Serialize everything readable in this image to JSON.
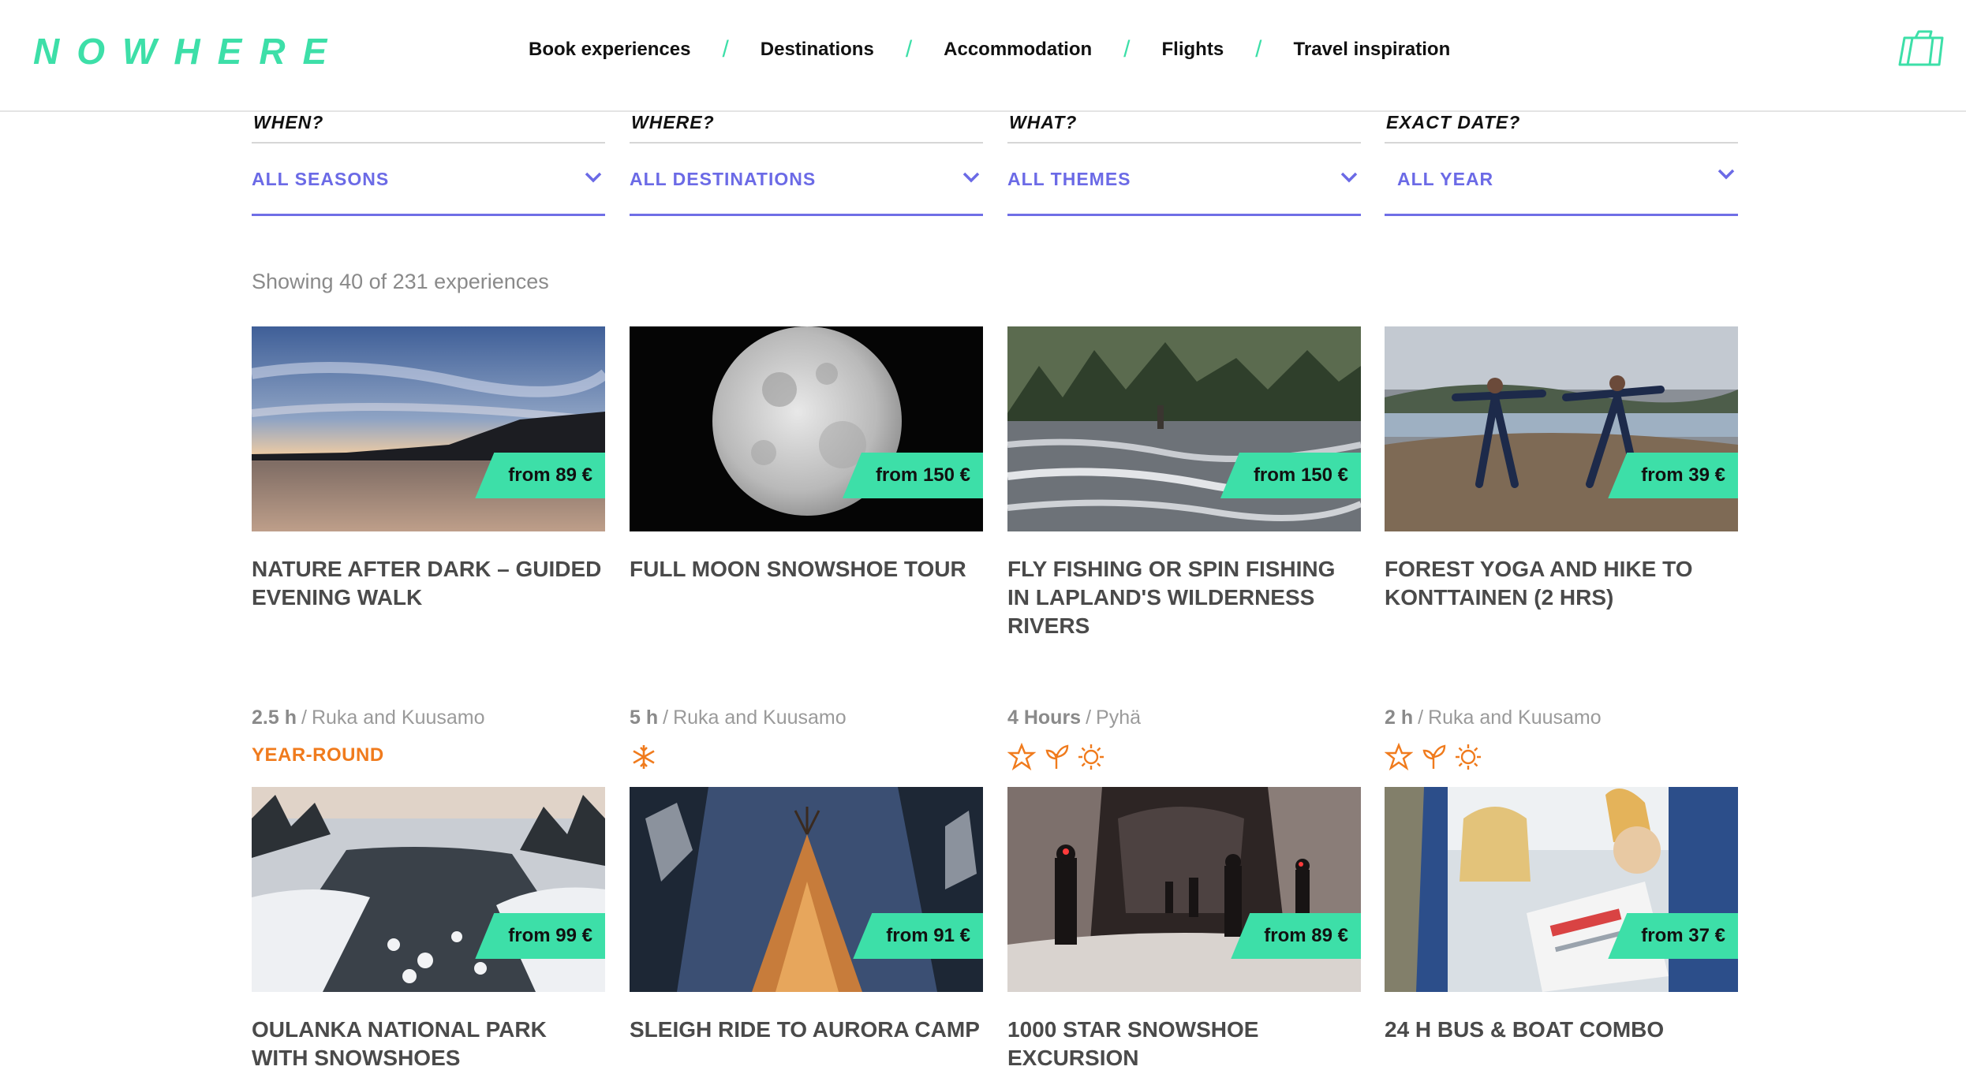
{
  "header": {
    "logo": "NOWHERE",
    "nav": [
      "Book experiences",
      "Destinations",
      "Accommodation",
      "Flights",
      "Travel inspiration"
    ],
    "separator": "/",
    "cart_icon": "suitcase-icon"
  },
  "filters": [
    {
      "label": "WHEN?",
      "value": "ALL SEASONS"
    },
    {
      "label": "WHERE?",
      "value": "ALL DESTINATIONS"
    },
    {
      "label": "WHAT?",
      "value": "ALL THEMES"
    },
    {
      "label": "EXACT DATE?",
      "value": "ALL YEAR"
    }
  ],
  "showing": "Showing 40 of 231 experiences",
  "cards": [
    {
      "price": "from 89 €",
      "title": "NATURE AFTER DARK – GUIDED EVENING WALK",
      "duration": "2.5 h",
      "location": "Ruka and Kuusamo",
      "season_text": "YEAR-ROUND",
      "season_icons": []
    },
    {
      "price": "from 150 €",
      "title": "FULL MOON SNOWSHOE TOUR",
      "duration": "5 h",
      "location": "Ruka and Kuusamo",
      "season_text": "",
      "season_icons": [
        "snowflake-icon"
      ]
    },
    {
      "price": "from 150 €",
      "title": "FLY FISHING OR SPIN FISHING IN LAPLAND'S WILDERNESS RIVERS",
      "duration": "4 Hours",
      "location": "Pyhä",
      "season_text": "",
      "season_icons": [
        "star-icon",
        "leaf-icon",
        "sun-icon"
      ]
    },
    {
      "price": "from 39 €",
      "title": "FOREST YOGA AND HIKE TO KONTTAINEN (2 HRS)",
      "duration": "2 h",
      "location": "Ruka and Kuusamo",
      "season_text": "",
      "season_icons": [
        "star-icon",
        "leaf-icon",
        "sun-icon"
      ]
    },
    {
      "price": "from 99 €",
      "title": "OULANKA NATIONAL PARK WITH SNOWSHOES",
      "duration": "",
      "location": "",
      "season_text": "",
      "season_icons": []
    },
    {
      "price": "from 91 €",
      "title": "SLEIGH RIDE TO AURORA CAMP",
      "duration": "",
      "location": "",
      "season_text": "",
      "season_icons": []
    },
    {
      "price": "from 89 €",
      "title": "1000 STAR SNOWSHOE EXCURSION",
      "duration": "",
      "location": "",
      "season_text": "",
      "season_icons": []
    },
    {
      "price": "from 37 €",
      "title": "24 H BUS & BOAT COMBO",
      "duration": "",
      "location": "",
      "season_text": "",
      "season_icons": []
    }
  ],
  "colors": {
    "brand": "#3ddfa8",
    "filter_accent": "#6b6ae6",
    "season_accent": "#f07b1d"
  }
}
